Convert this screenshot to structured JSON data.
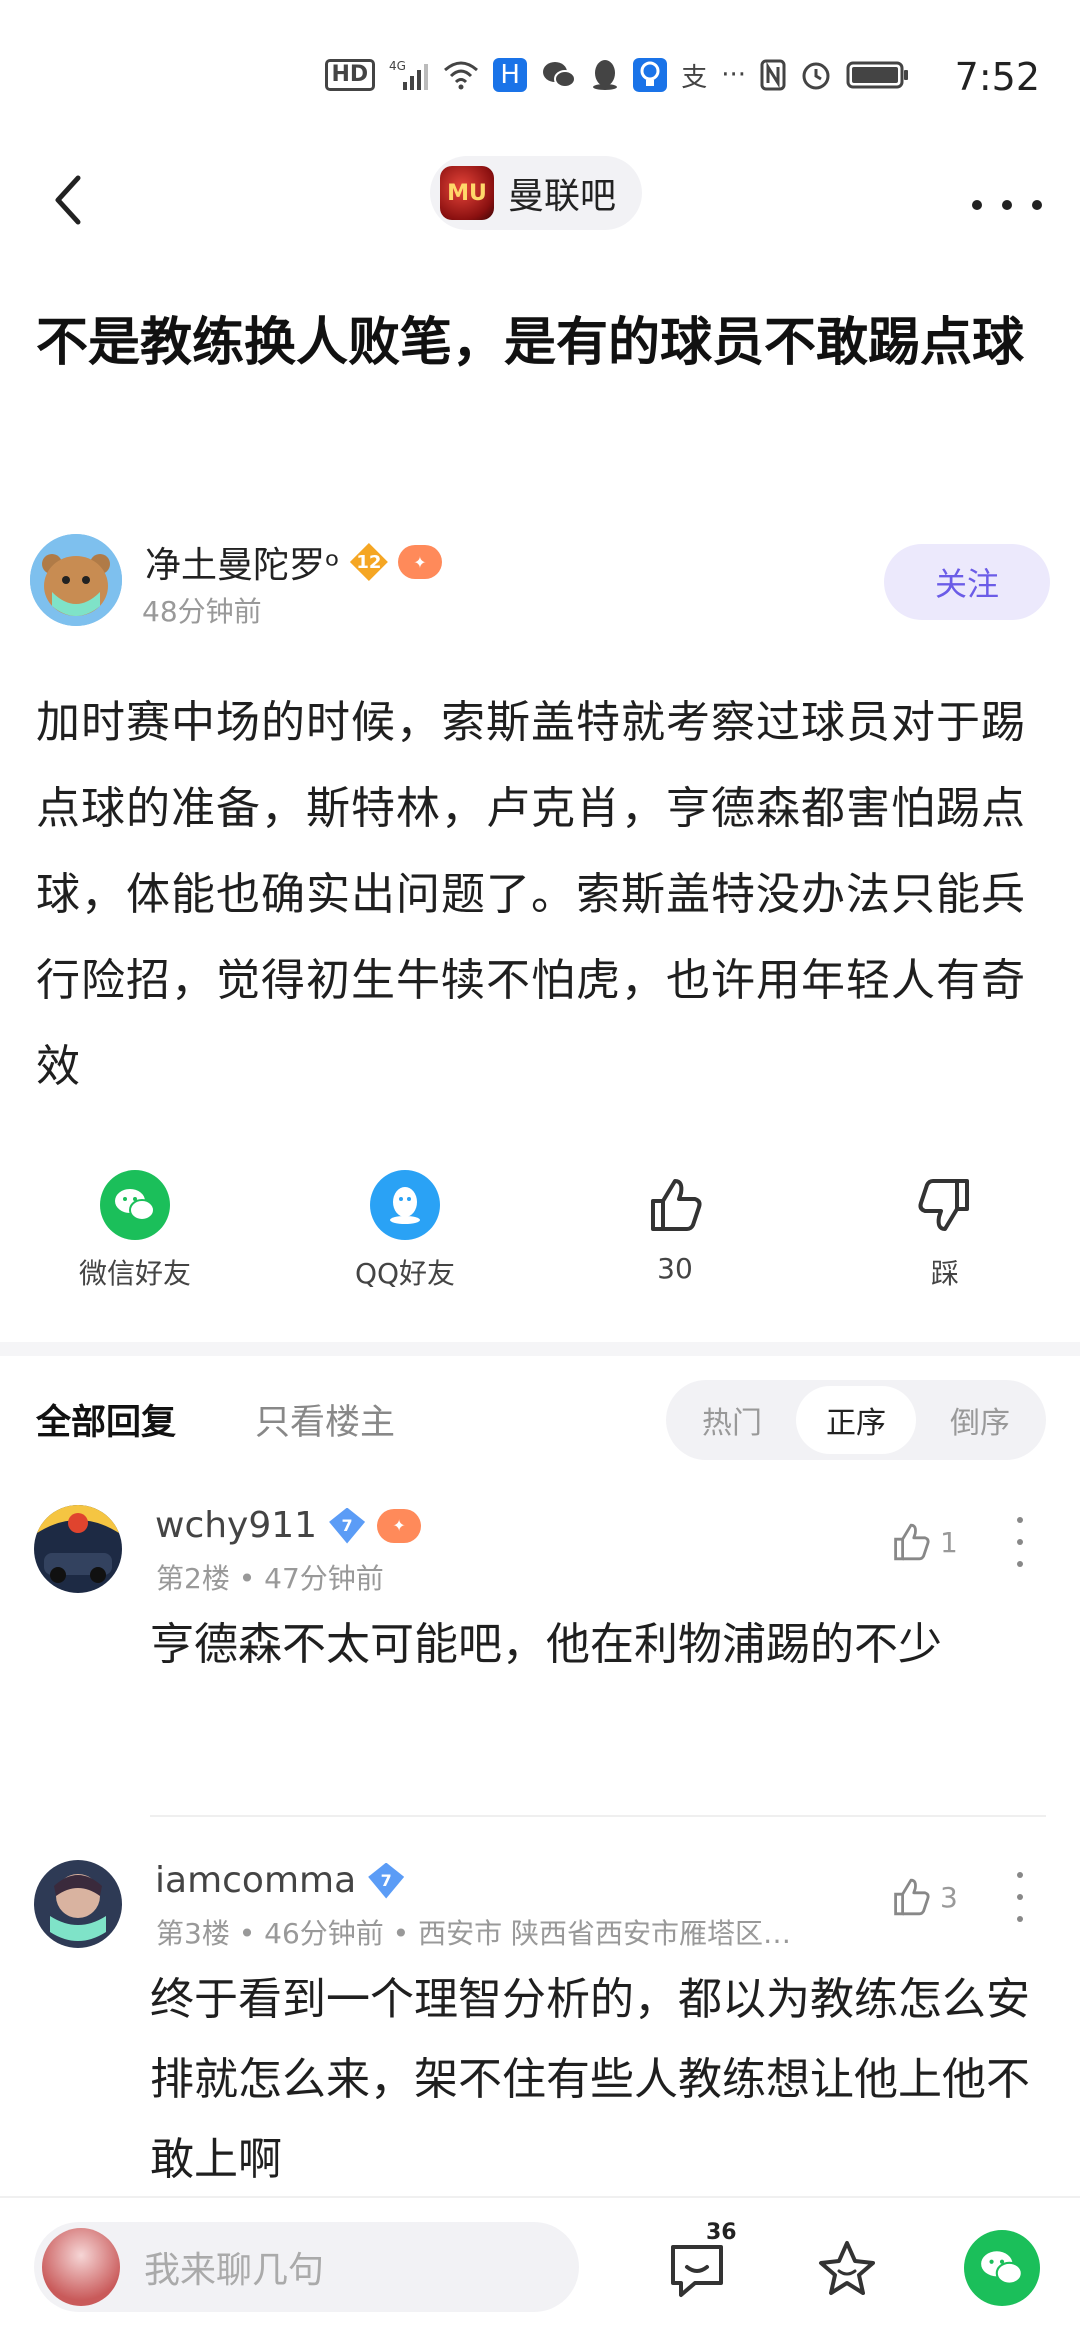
{
  "status_bar": {
    "time": "7:52",
    "icons": [
      "hd-icon",
      "signal-4g-icon",
      "wifi-icon",
      "app-h-icon",
      "wechat-icon",
      "qq-icon",
      "bulb-icon",
      "alipay-icon",
      "more-dots-icon",
      "nfc-icon",
      "alarm-icon",
      "battery-icon"
    ],
    "hd_text": "HD",
    "net_text": "4G"
  },
  "nav": {
    "forum_name": "曼联吧",
    "forum_logo_text": "MU"
  },
  "post": {
    "title": "不是教练换人败笔，是有的球员不敢踢点球",
    "author": "净土曼陀罗ᵒ",
    "level_badge": "12",
    "time": "48分钟前",
    "follow_label": "关注",
    "body": "加时赛中场的时候，索斯盖特就考察过球员对于踢点球的准备，斯特林，卢克肖，亨德森都害怕踢点球，体能也确实出问题了。索斯盖特没办法只能兵行险招，觉得初生牛犊不怕虎，也许用年轻人有奇效"
  },
  "actions": {
    "wechat_label": "微信好友",
    "qq_label": "QQ好友",
    "like_count": "30",
    "dislike_label": "踩"
  },
  "replies": {
    "tab_all": "全部回复",
    "tab_op_only": "只看楼主",
    "sort": {
      "hot": "热门",
      "asc": "正序",
      "desc": "倒序",
      "active": "正序"
    }
  },
  "comments": [
    {
      "name": "wchy911",
      "badge": "7",
      "meta": "第2楼 • 47分钟前",
      "likes": "1",
      "text": "亨德森不太可能吧，他在利物浦踢的不少"
    },
    {
      "name": "iamcomma",
      "badge": "7",
      "meta": "第3楼 • 46分钟前 • 西安市 陕西省西安市雁塔区…",
      "likes": "3",
      "text": "终于看到一个理智分析的，都以为教练怎么安排就怎么来，架不住有些人教练想让他上他不敢上啊"
    }
  ],
  "bottom_bar": {
    "placeholder": "我来聊几句",
    "comment_count": "36"
  },
  "colors": {
    "accent_purple": "#6b5ce7",
    "follow_bg": "#ece9fc",
    "wechat_green": "#1bbf5a",
    "qq_blue": "#2aa2f5",
    "badge_blue": "#5b9cf6",
    "badge_orange": "#f5a623"
  }
}
